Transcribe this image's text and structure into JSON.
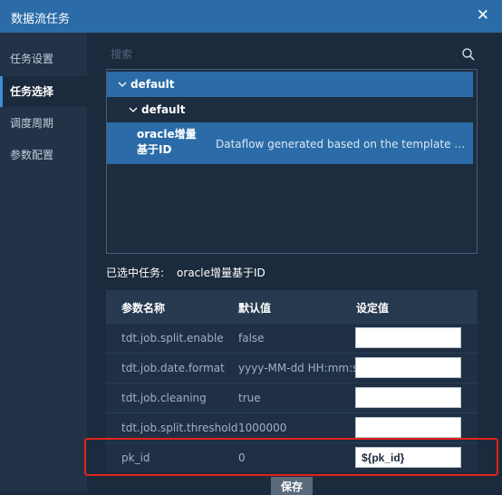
{
  "window": {
    "title": "数据流任务"
  },
  "sidebar": {
    "items": [
      {
        "label": "任务设置"
      },
      {
        "label": "任务选择"
      },
      {
        "label": "调度周期"
      },
      {
        "label": "参数配置"
      }
    ]
  },
  "search": {
    "placeholder": "搜索"
  },
  "tree": {
    "root": "default",
    "child": "default",
    "task": {
      "name": "oracle增量基于ID",
      "description": "Dataflow generated based on the template named 增..."
    }
  },
  "selected": {
    "label": "已选中任务:",
    "value": "oracle增量基于ID"
  },
  "table": {
    "headers": [
      "参数名称",
      "默认值",
      "设定值"
    ],
    "rows": [
      {
        "name": "tdt.job.split.enable",
        "default": "false",
        "value": ""
      },
      {
        "name": "tdt.job.date.format",
        "default": "yyyy-MM-dd HH:mm:ss",
        "value": ""
      },
      {
        "name": "tdt.job.cleaning",
        "default": "true",
        "value": ""
      },
      {
        "name": "tdt.job.split.threshold",
        "default": "1000000",
        "value": ""
      },
      {
        "name": "pk_id",
        "default": "0",
        "value": "${pk_id}"
      }
    ]
  },
  "footer": {
    "save_label": "保存"
  },
  "colors": {
    "accent": "#2b6ca8",
    "background": "#1b2a3c",
    "highlight": "#e2231a"
  }
}
